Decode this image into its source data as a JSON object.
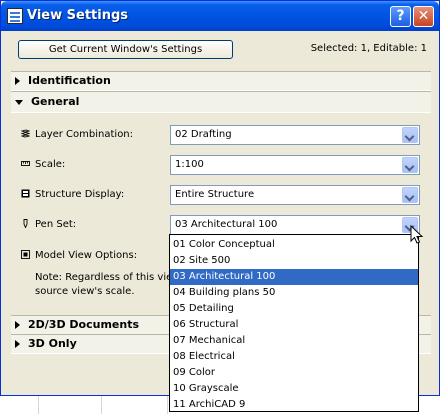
{
  "window": {
    "title": "View Settings",
    "help_label": "?",
    "close_label": "✕"
  },
  "toolbar": {
    "get_settings_label": "Get Current Window's Settings",
    "status": "Selected: 1, Editable: 1"
  },
  "sections": {
    "identification": "Identification",
    "general": "General",
    "documents": "2D/3D Documents",
    "only3d": "3D Only"
  },
  "fields": {
    "layer_label": "Layer Combination:",
    "layer_value": "02 Drafting",
    "scale_label": "Scale:",
    "scale_value": "1:100",
    "structure_label": "Structure Display:",
    "structure_value": "Entire Structure",
    "penset_label": "Pen Set:",
    "penset_value": "03 Architectural 100",
    "modelview_label": "Model View Options:",
    "note_line1": "Note: Regardless of this view's",
    "note_line2": "source view's scale."
  },
  "dropdown": {
    "items": [
      "01 Color Conceptual",
      "02 Site 500",
      "03 Architectural 100",
      "04 Building plans 50",
      "05 Detailing",
      "06 Structural",
      "07 Mechanical",
      "08 Electrical",
      "09 Color",
      "10 Grayscale",
      "11 ArchiCAD 9"
    ],
    "selected_index": 2
  },
  "colors": {
    "titlebar": "#0054e3",
    "selection": "#316ac5",
    "dialog_bg": "#ece9d8"
  }
}
